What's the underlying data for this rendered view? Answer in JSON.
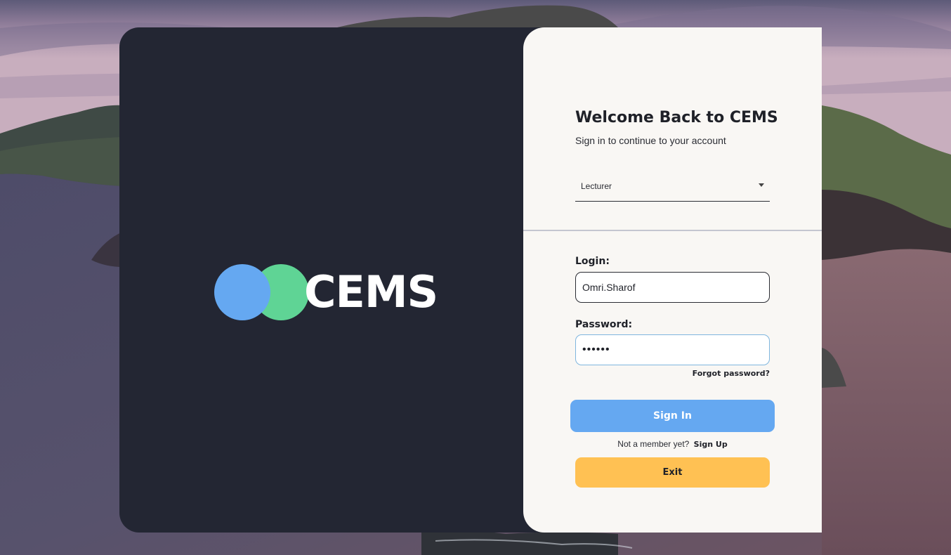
{
  "brand": {
    "logo_text": "CEMS",
    "circle_colors": [
      "#65a8f1",
      "#5fd495"
    ]
  },
  "login_form": {
    "title": "Welcome Back to CEMS",
    "subtitle": "Sign in to continue to your account",
    "role_select": {
      "selected": "Lecturer"
    },
    "login": {
      "label": "Login:",
      "value": "Omri.Sharof"
    },
    "password": {
      "label": "Password:",
      "value": "••••••"
    },
    "forgot_password_label": "Forgot password?",
    "sign_in_label": "Sign In",
    "member_prompt": "Not a member yet?",
    "sign_up_label": "Sign Up",
    "exit_label": "Exit"
  },
  "colors": {
    "left_panel_bg": "#232633",
    "right_panel_bg": "#f9f7f4",
    "primary_button": "#65a8f1",
    "exit_button": "#ffc153",
    "focus_border": "#7fb6de"
  }
}
